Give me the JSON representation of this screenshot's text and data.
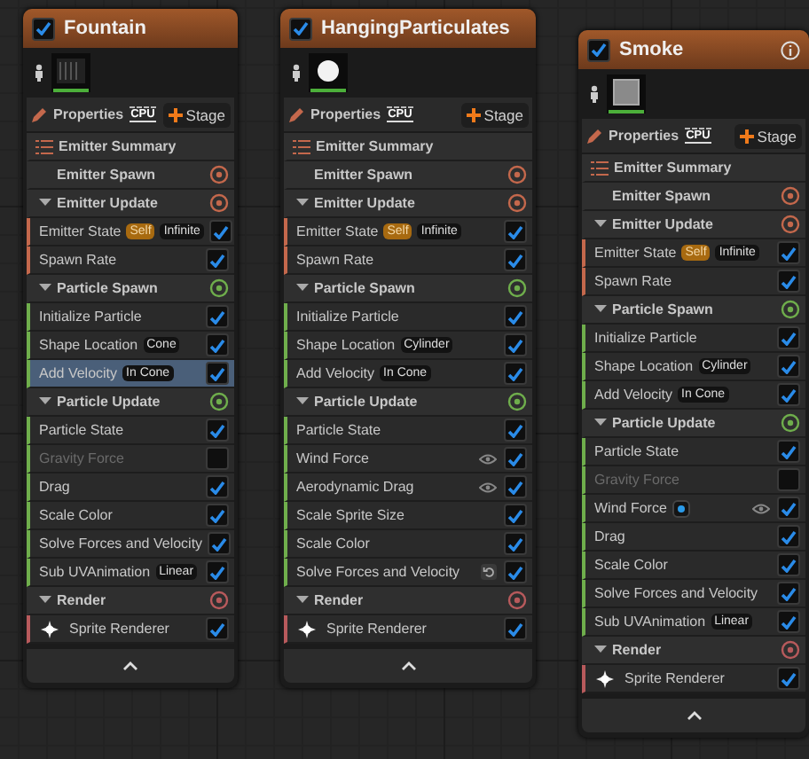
{
  "emitters": [
    {
      "name": "Fountain",
      "enabled": true,
      "info": false,
      "properties_label": "Properties",
      "sim_target": "CPU",
      "stage_button": "Stage",
      "summary": "Emitter Summary",
      "groups": [
        {
          "label": "Emitter Spawn",
          "color": "#c4684c"
        },
        {
          "label": "Emitter Update",
          "color": "#c4684c",
          "expanded": true,
          "modules": [
            {
              "kind": "module",
              "label": "Emitter State",
              "chips": [
                {
                  "kind": "accent",
                  "text": "Self"
                },
                {
                  "kind": "plain",
                  "text": "Infinite"
                }
              ],
              "checked": true,
              "selected": false
            },
            {
              "kind": "module",
              "label": "Spawn Rate",
              "checked": true,
              "selected": false
            }
          ]
        },
        {
          "label": "Particle Spawn",
          "color": "#6fae4c",
          "expanded": true,
          "modules": [
            {
              "kind": "module",
              "label": "Initialize Particle",
              "checked": true,
              "selected": false
            },
            {
              "kind": "module",
              "label": "Shape Location",
              "chips": [
                {
                  "kind": "plain",
                  "text": "Cone"
                }
              ],
              "checked": true,
              "selected": false
            },
            {
              "kind": "module",
              "label": "Add Velocity",
              "chips": [
                {
                  "kind": "plain",
                  "text": "In Cone"
                }
              ],
              "checked": true,
              "selected": true
            }
          ]
        },
        {
          "label": "Particle Update",
          "color": "#6fae4c",
          "expanded": true,
          "modules": [
            {
              "kind": "module",
              "label": "Particle State",
              "checked": true,
              "selected": false
            },
            {
              "kind": "module",
              "label": "Gravity Force",
              "checked": false,
              "selected": false
            },
            {
              "kind": "module",
              "label": "Drag",
              "checked": true,
              "selected": false
            },
            {
              "kind": "module",
              "label": "Scale Color",
              "checked": true,
              "selected": false
            },
            {
              "kind": "module",
              "label": "Solve Forces and Velocity",
              "checked": true,
              "selected": false
            },
            {
              "kind": "module",
              "label": "Sub UVAnimation",
              "chips": [
                {
                  "kind": "plain",
                  "text": "Linear"
                }
              ],
              "checked": true,
              "selected": false
            }
          ]
        },
        {
          "label": "Render",
          "color": "#b85a5c",
          "expanded": true,
          "modules": [
            {
              "kind": "renderer",
              "label": "Sprite Renderer",
              "checked": true,
              "selected": false
            }
          ]
        }
      ]
    },
    {
      "name": "HangingParticulates",
      "enabled": true,
      "info": false,
      "properties_label": "Properties",
      "sim_target": "CPU",
      "stage_button": "Stage",
      "summary": "Emitter Summary",
      "groups": [
        {
          "label": "Emitter Spawn",
          "color": "#c4684c"
        },
        {
          "label": "Emitter Update",
          "color": "#c4684c",
          "expanded": true,
          "modules": [
            {
              "kind": "module",
              "label": "Emitter State",
              "chips": [
                {
                  "kind": "accent",
                  "text": "Self"
                },
                {
                  "kind": "plain",
                  "text": "Infinite"
                }
              ],
              "checked": true,
              "selected": false
            },
            {
              "kind": "module",
              "label": "Spawn Rate",
              "checked": true,
              "selected": false
            }
          ]
        },
        {
          "label": "Particle Spawn",
          "color": "#6fae4c",
          "expanded": true,
          "modules": [
            {
              "kind": "module",
              "label": "Initialize Particle",
              "checked": true,
              "selected": false
            },
            {
              "kind": "module",
              "label": "Shape Location",
              "chips": [
                {
                  "kind": "plain",
                  "text": "Cylinder"
                }
              ],
              "checked": true,
              "selected": false
            },
            {
              "kind": "module",
              "label": "Add Velocity",
              "chips": [
                {
                  "kind": "plain",
                  "text": "In Cone"
                }
              ],
              "checked": true,
              "selected": false
            }
          ]
        },
        {
          "label": "Particle Update",
          "color": "#6fae4c",
          "expanded": true,
          "modules": [
            {
              "kind": "module",
              "label": "Particle State",
              "checked": true,
              "selected": false
            },
            {
              "kind": "module",
              "label": "Wind Force",
              "eye": true,
              "checked": true,
              "selected": false
            },
            {
              "kind": "module",
              "label": "Aerodynamic Drag",
              "eye": true,
              "checked": true,
              "selected": false
            },
            {
              "kind": "module",
              "label": "Scale Sprite Size",
              "checked": true,
              "selected": false
            },
            {
              "kind": "module",
              "label": "Scale Color",
              "checked": true,
              "selected": false
            },
            {
              "kind": "module",
              "label": "Solve Forces and Velocity",
              "reset": true,
              "checked": true,
              "selected": false
            }
          ]
        },
        {
          "label": "Render",
          "color": "#b85a5c",
          "expanded": true,
          "modules": [
            {
              "kind": "renderer",
              "label": "Sprite Renderer",
              "checked": true,
              "selected": false
            }
          ]
        }
      ]
    },
    {
      "name": "Smoke",
      "enabled": true,
      "info": true,
      "properties_label": "Properties",
      "sim_target": "CPU",
      "stage_button": "Stage",
      "summary": "Emitter Summary",
      "groups": [
        {
          "label": "Emitter Spawn",
          "color": "#c4684c"
        },
        {
          "label": "Emitter Update",
          "color": "#c4684c",
          "expanded": true,
          "modules": [
            {
              "kind": "module",
              "label": "Emitter State",
              "chips": [
                {
                  "kind": "accent",
                  "text": "Self"
                },
                {
                  "kind": "plain",
                  "text": "Infinite"
                }
              ],
              "checked": true,
              "selected": false
            },
            {
              "kind": "module",
              "label": "Spawn Rate",
              "checked": true,
              "selected": false
            }
          ]
        },
        {
          "label": "Particle Spawn",
          "color": "#6fae4c",
          "expanded": true,
          "modules": [
            {
              "kind": "module",
              "label": "Initialize Particle",
              "checked": true,
              "selected": false
            },
            {
              "kind": "module",
              "label": "Shape Location",
              "chips": [
                {
                  "kind": "plain",
                  "text": "Cylinder"
                }
              ],
              "checked": true,
              "selected": false
            },
            {
              "kind": "module",
              "label": "Add Velocity",
              "chips": [
                {
                  "kind": "plain",
                  "text": "In Cone"
                }
              ],
              "checked": true,
              "selected": false
            }
          ]
        },
        {
          "label": "Particle Update",
          "color": "#6fae4c",
          "expanded": true,
          "modules": [
            {
              "kind": "module",
              "label": "Particle State",
              "checked": true,
              "selected": false
            },
            {
              "kind": "module",
              "label": "Gravity Force",
              "checked": false,
              "selected": false
            },
            {
              "kind": "module",
              "label": "Wind Force",
              "chips": [
                {
                  "kind": "dot"
                }
              ],
              "eye": true,
              "checked": true,
              "selected": false
            },
            {
              "kind": "module",
              "label": "Drag",
              "checked": true,
              "selected": false
            },
            {
              "kind": "module",
              "label": "Scale Color",
              "checked": true,
              "selected": false
            },
            {
              "kind": "module",
              "label": "Solve Forces and Velocity",
              "checked": true,
              "selected": false
            },
            {
              "kind": "module",
              "label": "Sub UVAnimation",
              "chips": [
                {
                  "kind": "plain",
                  "text": "Linear"
                }
              ],
              "checked": true,
              "selected": false
            }
          ]
        },
        {
          "label": "Render",
          "color": "#b85a5c",
          "expanded": true,
          "modules": [
            {
              "kind": "renderer",
              "label": "Sprite Renderer",
              "checked": true,
              "selected": false
            }
          ]
        }
      ]
    }
  ]
}
